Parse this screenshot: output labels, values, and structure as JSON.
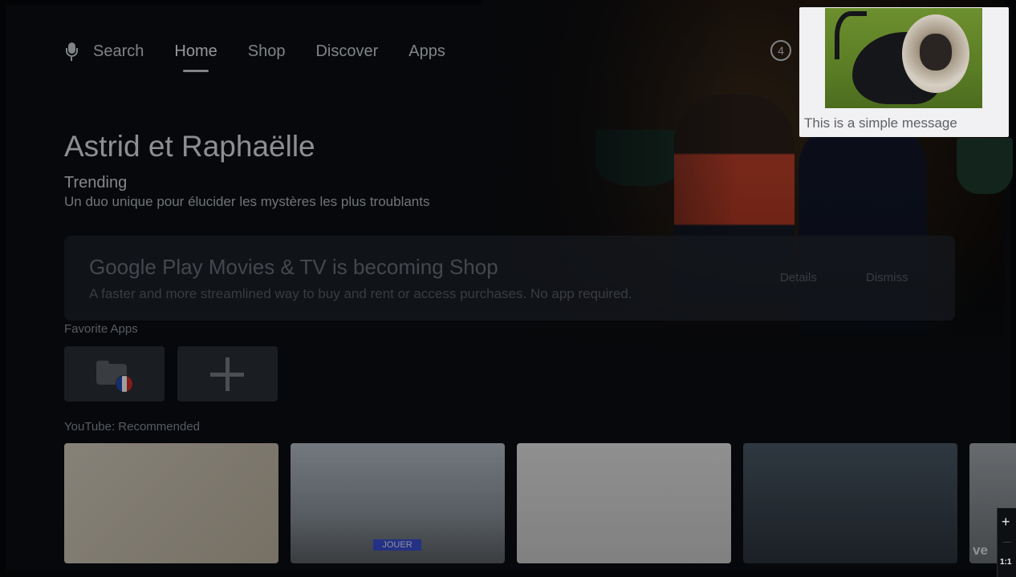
{
  "nav": {
    "search_label": "Search",
    "items": [
      {
        "label": "Home",
        "active": true
      },
      {
        "label": "Shop",
        "active": false
      },
      {
        "label": "Discover",
        "active": false
      },
      {
        "label": "Apps",
        "active": false
      }
    ],
    "notification_count": "4"
  },
  "hero": {
    "title": "Astrid et Raphaëlle",
    "subtitle": "Trending",
    "description": "Un duo unique pour élucider les mystères les plus troublants"
  },
  "promo": {
    "title": "Google Play Movies & TV is becoming Shop",
    "text": "A faster and more streamlined way to buy and rent or access purchases. No app required.",
    "details_label": "Details",
    "dismiss_label": "Dismiss"
  },
  "favorite_apps": {
    "label": "Favorite Apps",
    "flag_colors": [
      "#1f4bb5",
      "#ffffff",
      "#d62b2b"
    ]
  },
  "youtube": {
    "label": "YouTube: Recommended",
    "thumb2_badge": "JOUER",
    "thumb5_text": "ve"
  },
  "toast": {
    "message": "This is a simple message"
  },
  "zoom": {
    "plus": "+",
    "ratio": "1:1"
  }
}
